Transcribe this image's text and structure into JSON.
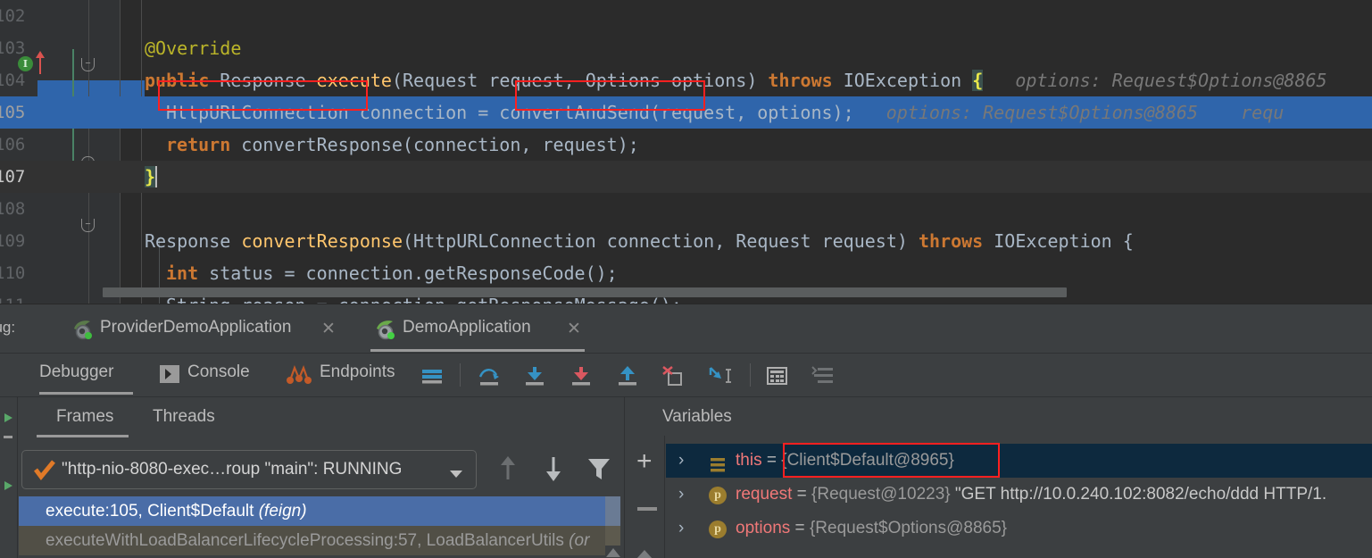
{
  "editor": {
    "lines": [
      {
        "num": "102",
        "indent": 0,
        "text": "",
        "kind": "blank"
      },
      {
        "num": "103",
        "indent": 0,
        "text": "@Override",
        "kind": "annotation"
      },
      {
        "num": "104",
        "indent": 0,
        "text": "public Response execute(Request request, Options options) throws IOException {",
        "hint": "options: Request$Options@8865",
        "kind": "signature"
      },
      {
        "num": "105",
        "indent": 1,
        "text": "HttpURLConnection connection = convertAndSend(request, options);",
        "hint": "options: Request$Options@8865     requ",
        "kind": "current"
      },
      {
        "num": "106",
        "indent": 1,
        "text": "return convertResponse(connection, request);",
        "kind": "stmt"
      },
      {
        "num": "107",
        "indent": 0,
        "text": "}",
        "kind": "closebrace"
      },
      {
        "num": "108",
        "indent": 0,
        "text": "",
        "kind": "blank"
      },
      {
        "num": "109",
        "indent": 0,
        "text": "Response convertResponse(HttpURLConnection connection, Request request) throws IOException {",
        "kind": "signature2"
      },
      {
        "num": "110",
        "indent": 1,
        "text": "int status = connection.getResponseCode();",
        "kind": "stmt2"
      },
      {
        "num": "111",
        "indent": 1,
        "text": "String reason = connection.getResponseMessage();",
        "kind": "stmt3"
      }
    ],
    "tokens": {
      "override": "@Override",
      "public": "public",
      "response": "Response",
      "execute": "execute",
      "sig_args": "(Request request, Options options) ",
      "throws": "throws",
      "ioexception": " IOException ",
      "open_brace": "{",
      "hint_104": "options: Request$Options@8865",
      "httpurlconnection": "HttpURLConnection",
      "connection_eq": " connection = ",
      "convertandsend": "convertAndSend",
      "call_args": "(request, options);",
      "hint_105a": "options: Request$Options@8865",
      "hint_105b": "requ",
      "return": "return",
      "convertresponse_call": " convertResponse(connection, request);",
      "close_brace": "}",
      "response2": "Response ",
      "convertresponse": "convertResponse",
      "sig2_args": "(HttpURLConnection connection, Request request) ",
      "throws2": "throws",
      "ioexception2": " IOException {",
      "int": "int",
      "status_line": " status = connection.getResponseCode();",
      "string": "String",
      "reason_line": " reason = connection.getResponseMessage();"
    }
  },
  "run_tabs": {
    "label": "bug:",
    "tabs": [
      {
        "name": "ProviderDemoApplication",
        "active": false,
        "icon": "springboot-icon",
        "close": "✕"
      },
      {
        "name": "DemoApplication",
        "active": true,
        "icon": "springboot-icon",
        "close": "✕"
      }
    ]
  },
  "debug_toolbar": {
    "tabs": [
      {
        "label": "Debugger",
        "active": true,
        "icon": null
      },
      {
        "label": "Console",
        "active": false,
        "icon": "console-icon"
      },
      {
        "label": "Endpoints",
        "active": false,
        "icon": "endpoints-icon"
      }
    ],
    "buttons": [
      {
        "name": "mute-breakpoints-icon",
        "title": "Mute Breakpoints"
      },
      {
        "name": "step-over-icon",
        "title": "Step Over"
      },
      {
        "name": "step-into-icon",
        "title": "Step Into"
      },
      {
        "name": "force-step-into-icon",
        "title": "Force Step Into"
      },
      {
        "name": "step-out-icon",
        "title": "Step Out"
      },
      {
        "name": "drop-frame-icon",
        "title": "Drop Frame"
      },
      {
        "name": "run-to-cursor-icon",
        "title": "Run to Cursor"
      },
      {
        "name": "evaluate-expression-icon",
        "title": "Evaluate Expression"
      },
      {
        "name": "settings-lines-icon",
        "title": "Layout Settings"
      }
    ]
  },
  "frames_panel": {
    "tabs": [
      {
        "label": "Frames",
        "active": true
      },
      {
        "label": "Threads",
        "active": false
      }
    ],
    "thread_selector": {
      "value": "\"http-nio-8080-exec…roup \"main\": RUNNING",
      "status_icon": "checkmark-icon",
      "dropdown_icon": "chevron-down-icon"
    },
    "toolbar": [
      {
        "name": "move-up-icon"
      },
      {
        "name": "move-down-icon"
      },
      {
        "name": "filter-icon"
      }
    ],
    "rows": [
      {
        "text": "execute:105, Client$Default ",
        "italic": "(feign)",
        "selected": true
      },
      {
        "text": "executeWithLoadBalancerLifecycleProcessing:57, LoadBalancerUtils ",
        "italic": "(or",
        "selected": false
      }
    ]
  },
  "variables_panel": {
    "title": "Variables",
    "toolbar": [
      {
        "name": "add-watch-icon",
        "glyph": "+"
      },
      {
        "name": "remove-watch-icon",
        "glyph": "−"
      },
      {
        "name": "scroll-up-icon",
        "glyph": "▲"
      }
    ],
    "rows": [
      {
        "chevron": "›",
        "icon": "field-icon",
        "name": "this",
        "eq": " = ",
        "value": "{Client$Default@8965}",
        "extra": "",
        "selected": true,
        "highlighted": true
      },
      {
        "chevron": "›",
        "icon": "parameter-icon",
        "name": "request",
        "eq": " = ",
        "value": "{Request@10223} ",
        "extra": "\"GET http://10.0.240.102:8082/echo/ddd HTTP/1.",
        "selected": false,
        "highlighted": false
      },
      {
        "chevron": "›",
        "icon": "parameter-icon",
        "name": "options",
        "eq": " = ",
        "value": "{Request$Options@8865}",
        "extra": "",
        "selected": false,
        "highlighted": false
      }
    ]
  },
  "colors": {
    "editor_bg": "#2b2b2b",
    "gutter_bg": "#313335",
    "panel_bg": "#3c3f41",
    "current_line_hl": "#2f65ab",
    "frame_selected": "#4a6da7",
    "var_selected": "#0d293e",
    "annotation_red": "#ff2020",
    "keyword": "#cc7832",
    "method": "#ffc66d",
    "annotation_yellow": "#bbb529",
    "text": "#a9b7c6",
    "inline_hint": "#787878",
    "var_name": "#f07878"
  }
}
